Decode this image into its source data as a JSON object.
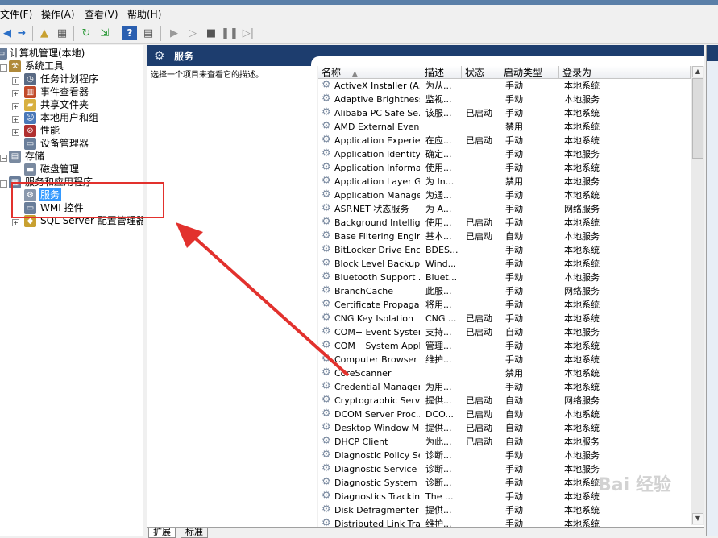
{
  "menu": [
    "文件(F)",
    "操作(A)",
    "查看(V)",
    "帮助(H)"
  ],
  "tree": {
    "root": "计算机管理(本地)",
    "system_tools": "系统工具",
    "task_scheduler": "任务计划程序",
    "event_viewer": "事件查看器",
    "shared_folders": "共享文件夹",
    "local_users": "本地用户和组",
    "performance": "性能",
    "device_manager": "设备管理器",
    "storage": "存储",
    "disk_management": "磁盘管理",
    "services_apps": "服务和应用程序",
    "services": "服务",
    "wmi": "WMI 控件",
    "sql_config": "SQL Server 配置管理器"
  },
  "main": {
    "title": "服务",
    "description_hint": "选择一个项目来查看它的描述。"
  },
  "columns": [
    "名称",
    "描述",
    "状态",
    "启动类型",
    "登录为"
  ],
  "services": [
    {
      "name": "ActiveX Installer (A...",
      "desc": "为从...",
      "status": "",
      "startup": "手动",
      "logon": "本地系统"
    },
    {
      "name": "Adaptive Brightness",
      "desc": "监视...",
      "status": "",
      "startup": "手动",
      "logon": "本地服务"
    },
    {
      "name": "Alibaba PC Safe Se...",
      "desc": "该服...",
      "status": "已启动",
      "startup": "手动",
      "logon": "本地系统"
    },
    {
      "name": "AMD External Even...",
      "desc": "",
      "status": "",
      "startup": "禁用",
      "logon": "本地系统"
    },
    {
      "name": "Application Experie...",
      "desc": "在应...",
      "status": "已启动",
      "startup": "手动",
      "logon": "本地系统"
    },
    {
      "name": "Application Identity",
      "desc": "确定...",
      "status": "",
      "startup": "手动",
      "logon": "本地服务"
    },
    {
      "name": "Application Informa...",
      "desc": "使用...",
      "status": "",
      "startup": "手动",
      "logon": "本地系统"
    },
    {
      "name": "Application Layer G...",
      "desc": "为 In...",
      "status": "",
      "startup": "禁用",
      "logon": "本地服务"
    },
    {
      "name": "Application Manage...",
      "desc": "为通...",
      "status": "",
      "startup": "手动",
      "logon": "本地系统"
    },
    {
      "name": "ASP.NET 状态服务",
      "desc": "为 A...",
      "status": "",
      "startup": "手动",
      "logon": "网络服务"
    },
    {
      "name": "Background Intellig...",
      "desc": "使用...",
      "status": "已启动",
      "startup": "手动",
      "logon": "本地系统"
    },
    {
      "name": "Base Filtering Engine",
      "desc": "基本...",
      "status": "已启动",
      "startup": "自动",
      "logon": "本地服务"
    },
    {
      "name": "BitLocker Drive Enc...",
      "desc": "BDES...",
      "status": "",
      "startup": "手动",
      "logon": "本地系统"
    },
    {
      "name": "Block Level Backup ...",
      "desc": "Wind...",
      "status": "",
      "startup": "手动",
      "logon": "本地系统"
    },
    {
      "name": "Bluetooth Support ...",
      "desc": "Bluet...",
      "status": "",
      "startup": "手动",
      "logon": "本地服务"
    },
    {
      "name": "BranchCache",
      "desc": "此服...",
      "status": "",
      "startup": "手动",
      "logon": "网络服务"
    },
    {
      "name": "Certificate Propaga...",
      "desc": "将用...",
      "status": "",
      "startup": "手动",
      "logon": "本地系统"
    },
    {
      "name": "CNG Key Isolation",
      "desc": "CNG ...",
      "status": "已启动",
      "startup": "手动",
      "logon": "本地系统"
    },
    {
      "name": "COM+ Event System",
      "desc": "支持...",
      "status": "已启动",
      "startup": "自动",
      "logon": "本地服务"
    },
    {
      "name": "COM+ System Appl...",
      "desc": "管理...",
      "status": "",
      "startup": "手动",
      "logon": "本地系统"
    },
    {
      "name": "Computer Browser",
      "desc": "维护...",
      "status": "",
      "startup": "手动",
      "logon": "本地系统"
    },
    {
      "name": "CoreScanner",
      "desc": "",
      "status": "",
      "startup": "禁用",
      "logon": "本地系统"
    },
    {
      "name": "Credential Manager",
      "desc": "为用...",
      "status": "",
      "startup": "手动",
      "logon": "本地系统"
    },
    {
      "name": "Cryptographic Serv...",
      "desc": "提供...",
      "status": "已启动",
      "startup": "自动",
      "logon": "网络服务"
    },
    {
      "name": "DCOM Server Proc...",
      "desc": "DCO...",
      "status": "已启动",
      "startup": "自动",
      "logon": "本地系统"
    },
    {
      "name": "Desktop Window M...",
      "desc": "提供...",
      "status": "已启动",
      "startup": "自动",
      "logon": "本地系统"
    },
    {
      "name": "DHCP Client",
      "desc": "为此...",
      "status": "已启动",
      "startup": "自动",
      "logon": "本地服务"
    },
    {
      "name": "Diagnostic Policy Se...",
      "desc": "诊断...",
      "status": "",
      "startup": "手动",
      "logon": "本地服务"
    },
    {
      "name": "Diagnostic Service ...",
      "desc": "诊断...",
      "status": "",
      "startup": "手动",
      "logon": "本地服务"
    },
    {
      "name": "Diagnostic System ...",
      "desc": "诊断...",
      "status": "",
      "startup": "手动",
      "logon": "本地系统"
    },
    {
      "name": "Diagnostics Trackin...",
      "desc": "The ...",
      "status": "",
      "startup": "手动",
      "logon": "本地系统"
    },
    {
      "name": "Disk Defragmenter",
      "desc": "提供...",
      "status": "",
      "startup": "手动",
      "logon": "本地系统"
    },
    {
      "name": "Distributed Link Tra...",
      "desc": "维护...",
      "status": "",
      "startup": "手动",
      "logon": "本地系统"
    }
  ],
  "tabs": [
    "扩展",
    "标准"
  ],
  "watermark": "Bai 经验",
  "colors": {
    "header_bg": "#1d3d6e",
    "highlight": "#e2312d",
    "selected": "#3399ff"
  }
}
